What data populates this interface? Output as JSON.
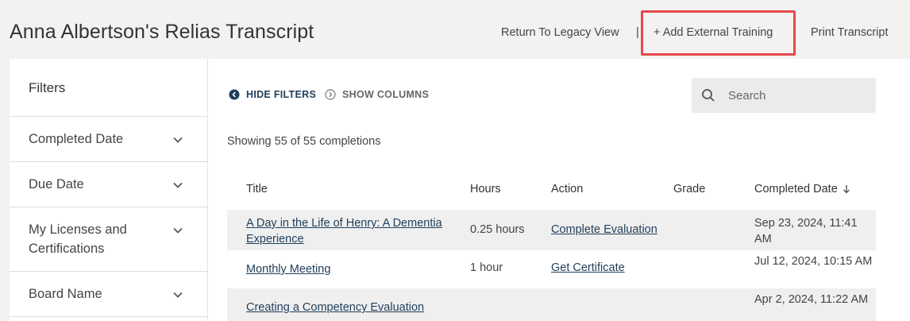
{
  "page_title": "Anna Albertson's Relias Transcript",
  "header_links": {
    "legacy": "Return To Legacy View",
    "divider": "|",
    "add_external": "+ Add External Training",
    "print": "Print Transcript"
  },
  "colors": {
    "highlight": "#e5484d",
    "link": "#1f3e5a",
    "row_alt": "#efefef"
  },
  "sidebar": {
    "title": "Filters",
    "items": [
      {
        "label": "Completed Date",
        "icon": "chevron-down-icon"
      },
      {
        "label": "Due Date",
        "icon": "chevron-down-icon"
      },
      {
        "label": "My Licenses and Certifications",
        "icon": "chevron-down-icon"
      },
      {
        "label": "Board Name",
        "icon": "chevron-down-icon"
      }
    ]
  },
  "toolbar": {
    "hide_filters": "HIDE FILTERS",
    "show_columns": "SHOW COLUMNS",
    "search_placeholder": "Search"
  },
  "summary": "Showing 55 of 55 completions",
  "table": {
    "columns": [
      "Title",
      "Hours",
      "Action",
      "Grade",
      "Completed Date"
    ],
    "sort_column": "Completed Date",
    "sort_direction": "descending",
    "rows": [
      {
        "title": "A Day in the Life of Henry: A Dementia Experience",
        "hours": "0.25 hours",
        "action": "Complete Evaluation",
        "grade": "",
        "completed": "Sep 23, 2024, 11:41 AM"
      },
      {
        "title": "Monthly Meeting",
        "hours": "1 hour",
        "action": "Get Certificate",
        "grade": "",
        "completed": "Jul 12, 2024, 10:15 AM"
      },
      {
        "title": "Creating a Competency Evaluation",
        "hours": "",
        "action": "",
        "grade": "",
        "completed": "Apr 2, 2024, 11:22 AM"
      }
    ]
  }
}
